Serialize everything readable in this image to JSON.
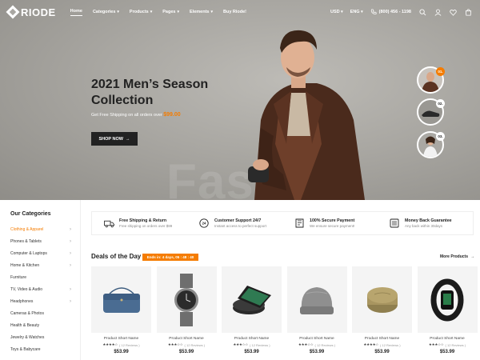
{
  "brand": {
    "name": "RIODE"
  },
  "nav": {
    "items": [
      {
        "label": "Home",
        "has_caret": false
      },
      {
        "label": "Categories",
        "has_caret": true
      },
      {
        "label": "Products",
        "has_caret": true
      },
      {
        "label": "Pages",
        "has_caret": true
      },
      {
        "label": "Elements",
        "has_caret": true
      },
      {
        "label": "Buy Riode!",
        "has_caret": false
      }
    ]
  },
  "header_right": {
    "currency": "USD",
    "language": "ENG",
    "phone": "(800) 456 - 1198",
    "icons": [
      "search-icon",
      "user-icon",
      "heart-icon",
      "cart-icon"
    ]
  },
  "hero": {
    "title": "2021 Men’s Season Collection",
    "subtitle_prefix": "Get Free Shipping on all orders over",
    "subtitle_price": "$99.00",
    "button_label": "SHOP NOW",
    "watermark": "Fashion",
    "thumbs": [
      {
        "num": "01.",
        "num_color": "#f57c00"
      },
      {
        "num": "02.",
        "num_color": "#ffffff"
      },
      {
        "num": "03.",
        "num_color": "#ffffff"
      }
    ]
  },
  "sidebar": {
    "title": "Our Categories",
    "items": [
      {
        "label": "Clothing & Apparel",
        "active": true,
        "caret": true
      },
      {
        "label": "Phones & Tablets",
        "active": false,
        "caret": true
      },
      {
        "label": "Computer & Laptops",
        "active": false,
        "caret": true
      },
      {
        "label": "Home & Kitchen",
        "active": false,
        "caret": true
      },
      {
        "label": "Furniture",
        "active": false,
        "caret": false
      },
      {
        "label": "TV, Video & Audio",
        "active": false,
        "caret": true
      },
      {
        "label": "Headphones",
        "active": false,
        "caret": true
      },
      {
        "label": "Cameras & Photos",
        "active": false,
        "caret": false
      },
      {
        "label": "Health & Beauty",
        "active": false,
        "caret": false
      },
      {
        "label": "Jewelry & Watches",
        "active": false,
        "caret": false
      },
      {
        "label": "Toys & Babycare",
        "active": false,
        "caret": false
      }
    ]
  },
  "features": [
    {
      "title": "Free Shipping & Return",
      "sub": "Free shipping on orders over $99",
      "icon": "truck-icon"
    },
    {
      "title": "Customer Support 24/7",
      "sub": "Instant access to perfect support",
      "icon": "support-icon"
    },
    {
      "title": "100% Secure Payment",
      "sub": "We ensure secure payment!",
      "icon": "shield-icon"
    },
    {
      "title": "Money Back Guarantee",
      "sub": "Any back within 30days",
      "icon": "money-icon"
    }
  ],
  "deals": {
    "title": "Deals of the Day",
    "badge": "Ends in: 4 days, 05 : 48 : 40",
    "more": "More Products",
    "products": [
      {
        "name": "Product Short Name",
        "rating": "( 12 Reviews )",
        "price": "$53.99",
        "image": "bag-icon",
        "stars": 4
      },
      {
        "name": "Product Short Name",
        "rating": "( 12 Reviews )",
        "price": "$53.99",
        "image": "watch-icon",
        "stars": 3
      },
      {
        "name": "Product Short Name",
        "rating": "( 12 Reviews )",
        "price": "$53.99",
        "image": "charger-icon",
        "stars": 3
      },
      {
        "name": "Product Short Name",
        "rating": "( 12 Reviews )",
        "price": "$53.99",
        "image": "beanie-icon",
        "stars": 3
      },
      {
        "name": "Product Short Name",
        "rating": "( 12 Reviews )",
        "price": "$53.99",
        "image": "soap-icon",
        "stars": 4
      },
      {
        "name": "Product Short Name",
        "rating": "( 12 Reviews )",
        "price": "$53.99",
        "image": "band-icon",
        "stars": 3
      }
    ]
  },
  "colors": {
    "accent": "#f57c00",
    "dark": "#222222"
  }
}
